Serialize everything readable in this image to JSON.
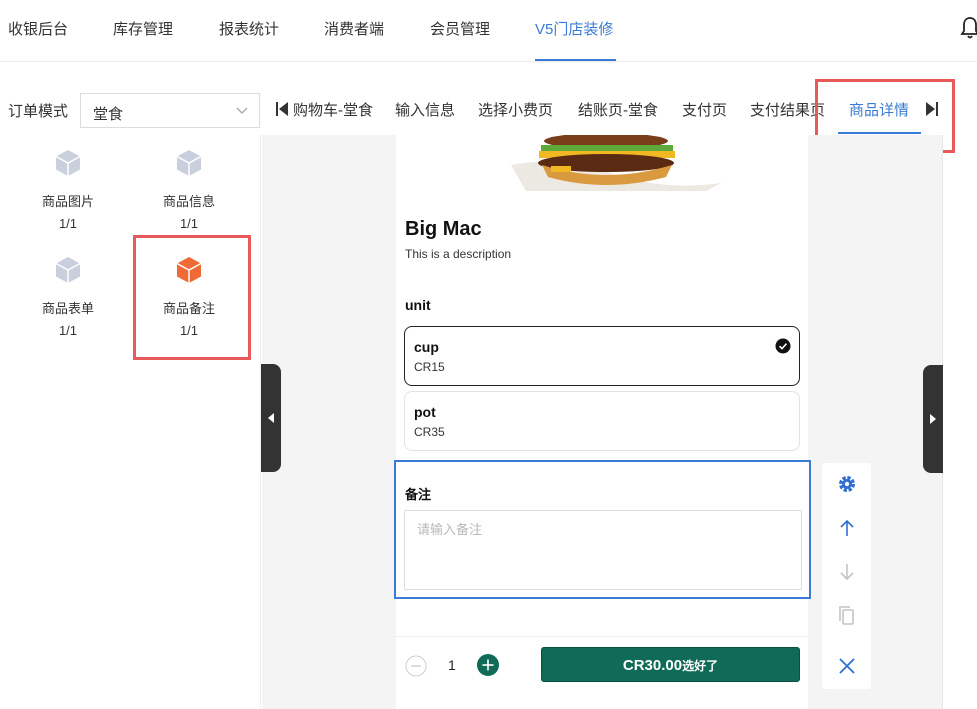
{
  "nav": {
    "items": [
      "收银后台",
      "库存管理",
      "报表统计",
      "消费者端",
      "会员管理",
      "V5门店装修"
    ],
    "active_index": 5,
    "bell_icon": "bell-icon"
  },
  "order_mode": {
    "label": "订单模式",
    "selected": "堂食"
  },
  "page_tabs": {
    "items": [
      "购物车-堂食",
      "输入信息",
      "选择小费页",
      "结账页-堂食",
      "支付页",
      "支付结果页",
      "商品详情"
    ],
    "active_index": 6
  },
  "components": [
    {
      "name": "商品图片",
      "count": "1/1",
      "active": false
    },
    {
      "name": "商品信息",
      "count": "1/1",
      "active": false
    },
    {
      "name": "商品表单",
      "count": "1/1",
      "active": false
    },
    {
      "name": "商品备注",
      "count": "1/1",
      "active": true
    }
  ],
  "product": {
    "title": "Big Mac",
    "description": "This is a description",
    "unit_label": "unit",
    "options": [
      {
        "name": "cup",
        "price": "CR15",
        "selected": true
      },
      {
        "name": "pot",
        "price": "CR35",
        "selected": false
      }
    ]
  },
  "note": {
    "label": "备注",
    "placeholder": "请输入备注"
  },
  "footer": {
    "quantity": "1",
    "cta_amount": "CR30.00",
    "cta_label": "选好了"
  },
  "colors": {
    "accent": "#3a7bd5",
    "highlight": "#e85a5a",
    "cta": "#0f6b57",
    "cube_inactive": "#c9cfdc",
    "cube_active": "#f06a35"
  },
  "toolbar": {
    "icons": [
      "gear-icon",
      "arrow-up-icon",
      "arrow-down-icon",
      "copy-icon",
      "close-icon"
    ]
  }
}
